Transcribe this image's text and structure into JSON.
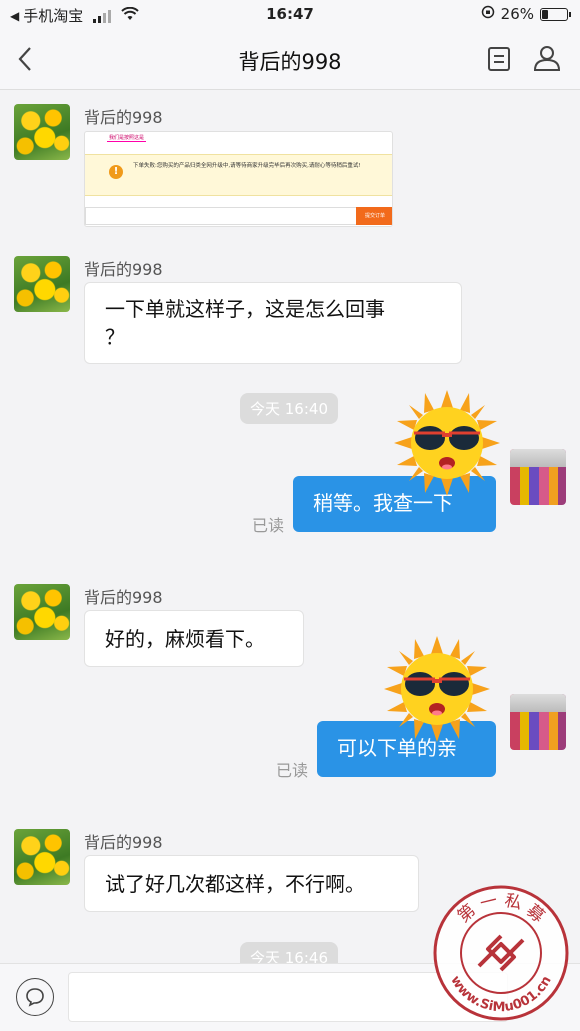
{
  "status_bar": {
    "back_app": "手机淘宝",
    "time": "16:47",
    "battery": "26%",
    "battery_level": 0.26
  },
  "nav": {
    "title": "背后的998"
  },
  "messages": {
    "m1_sender": "背后的998",
    "m1_image": {
      "tab": "我们是按照这是",
      "text": "下单失败:您购买的产品归类全网升级中,请等待商家升级完毕后再次购买,请耐心等待稍后重试!",
      "button": "提交订单"
    },
    "m2_sender": "背后的998",
    "m2_text_line1": "一下单就这样子，这是怎么回事",
    "m2_text_line2": "？",
    "time1": "今天 16:40",
    "m3_text": "稍等。我查一下",
    "m3_read": "已读",
    "m4_sender": "背后的998",
    "m4_text": "好的，麻烦看下。",
    "m5_text": "可以下单的亲",
    "m5_read": "已读",
    "m6_sender": "背后的998",
    "m6_text": "试了好几次都这样，不行啊。",
    "time2": "今天 16:46"
  },
  "watermark": {
    "top_text": "第 一 私 募",
    "bottom_text": "www.SiMu001.cn"
  },
  "icons": {
    "back": "chevron-left-icon",
    "doc": "document-icon",
    "user": "user-icon",
    "voice": "voice-icon"
  },
  "colors": {
    "bubble_out": "#2a93e6",
    "bubble_in": "#ffffff",
    "background": "#f3f3f5"
  }
}
